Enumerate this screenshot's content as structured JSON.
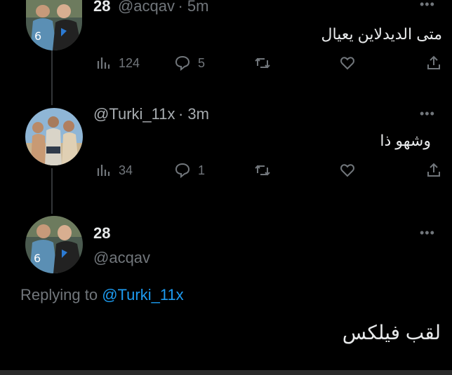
{
  "tweet1": {
    "name": "28",
    "handle": "@acqav",
    "time": "· 5m",
    "text": "متى الديدلاين يعيال",
    "views": "124",
    "replies": "5"
  },
  "tweet2": {
    "handle": "@Turki_11x",
    "time": "· 3m",
    "text": "وشهو ذا",
    "views": "34",
    "replies": "1"
  },
  "tweet3": {
    "name": "28",
    "handle": "@acqav",
    "replying_label": "Replying to",
    "replying_to": "@Turki_11x",
    "text": "لقب فيلكس"
  },
  "icons": {
    "views": "views-icon",
    "reply": "reply-icon",
    "retweet": "retweet-icon",
    "like": "like-icon",
    "share": "share-icon",
    "more": "more-icon"
  },
  "colors": {
    "background": "#000000",
    "text": "#e7e9ea",
    "muted": "#71767b",
    "mention": "#1d9bf0"
  }
}
